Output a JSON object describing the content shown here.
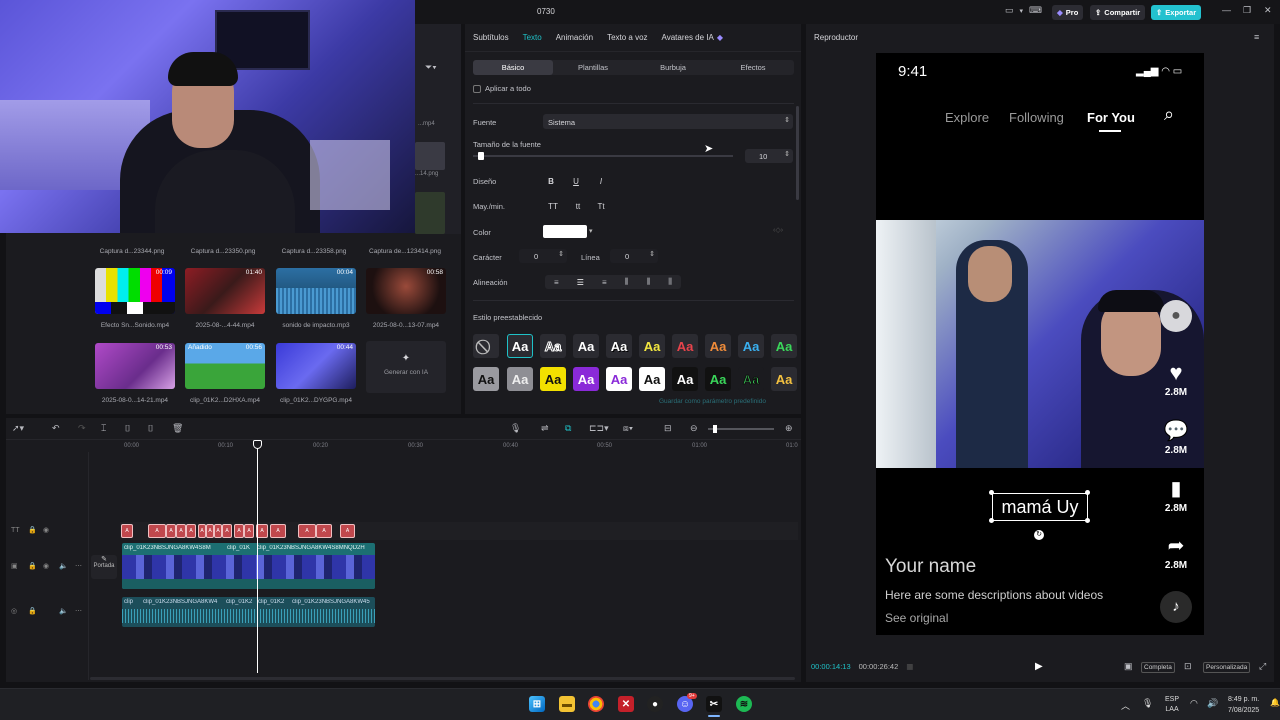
{
  "window": {
    "title": "0730",
    "pro_label": "Pro",
    "share_label": "Compartir",
    "export_label": "Exportar"
  },
  "media": {
    "filter_icon": "filter-icon",
    "top_items": [
      {
        "label": "Captura d...23344.png"
      },
      {
        "label": "Captura d...23350.png"
      },
      {
        "label": "Captura d...23358.png"
      },
      {
        "label": "Captura de...123414.png"
      }
    ],
    "mid_items": [
      {
        "label": "Efecto Sn...Sonido.mp4",
        "duration": "00:09"
      },
      {
        "label": "2025-08-...4-44.mp4",
        "duration": "01:40"
      },
      {
        "label": "sonido de impacto.mp3",
        "duration": "00:04"
      },
      {
        "label": "2025-08-0...13-07.mp4",
        "duration": "00:58"
      }
    ],
    "bottom_items": [
      {
        "label": "2025-08-0...14-21.mp4",
        "duration": "00:53"
      },
      {
        "label": "clip_01K2...D2HXA.mp4",
        "duration": "00:56",
        "badge": "Añadido"
      },
      {
        "label": "clip_01K2...DYGPG.mp4",
        "duration": "00:44"
      }
    ],
    "generate_label": "Generar con IA",
    "hidden_labels": [
      "...mp4",
      "...14.png",
      "...png"
    ]
  },
  "text_panel": {
    "tabs": [
      "Subtítulos",
      "Texto",
      "Animación",
      "Texto a voz",
      "Avatares de IA"
    ],
    "active_tab": "Texto",
    "subtabs": [
      "Básico",
      "Plantillas",
      "Burbuja",
      "Efectos"
    ],
    "apply_all": "Aplicar a todo",
    "font_label": "Fuente",
    "font_value": "Sistema",
    "size_label": "Tamaño de la fuente",
    "size_value": "10",
    "size_fraction": 0.02,
    "design_label": "Diseño",
    "design_buttons": [
      "B",
      "U",
      "I"
    ],
    "case_label": "May./min.",
    "case_buttons": [
      "TT",
      "tt",
      "Tt"
    ],
    "color_label": "Color",
    "color_value": "#ffffff",
    "char_label": "Carácter",
    "char_value": "0",
    "line_label": "Línea",
    "line_value": "0",
    "align_label": "Alineación",
    "preset_label": "Estilo preestablecido",
    "preset_sample": "Aa",
    "save_preset": "Guardar como parámetro predefinido"
  },
  "timeline": {
    "ticks": [
      "00:00",
      "00:10",
      "00:20",
      "00:30",
      "00:40",
      "00:50",
      "01:00",
      "01:0"
    ],
    "cover_label": "Portada",
    "chip_label": "A",
    "clip_labels": [
      "clip_01K23NBSJNGA8KW4S8M",
      "clip_01K",
      "clip_01K23NBSJNGA8KW4S8MNQD2H"
    ],
    "audio_labels": [
      "clip",
      "clip_01K23NBSJNGA8KW4",
      "clip_01K2",
      "clip_01K2",
      "clip_01K23NBSJNGA8KW45"
    ]
  },
  "player": {
    "title": "Reproductor",
    "status_time": "9:41",
    "nav": [
      "Explore",
      "Following",
      "For You"
    ],
    "caption": "mamá Uy",
    "counts": [
      "2.8M",
      "2.8M",
      "2.8M",
      "2.8M"
    ],
    "username": "Your name",
    "description": "Here are some descriptions about videos",
    "see_original": "See original",
    "current_time": "00:00:14:13",
    "total_time": "00:00:26:42",
    "full_label": "Completa",
    "custom_label": "Personalizada"
  },
  "taskbar": {
    "lang1": "ESP",
    "lang2": "LAA",
    "time": "8:49 p. m.",
    "date": "7/08/2025",
    "badge": "9+"
  },
  "colors": {
    "accent": "#1fc1c7",
    "export": "#23c1cf",
    "clip": "#1c6f72",
    "text_chip": "#c0484d"
  }
}
